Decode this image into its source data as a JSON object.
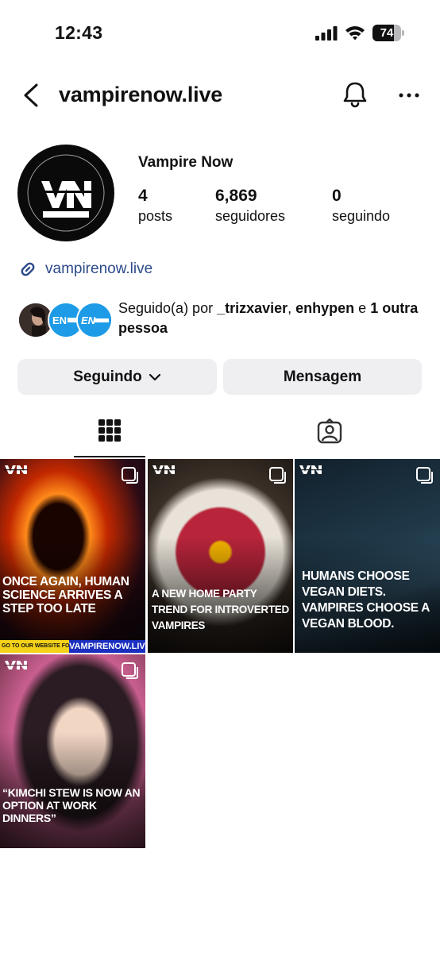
{
  "status_bar": {
    "time": "12:43",
    "battery_percent": 74
  },
  "header": {
    "username": "vampirenow.live",
    "icons": [
      "back-arrow-icon",
      "bell-icon",
      "more-icon"
    ]
  },
  "profile": {
    "display_name": "Vampire Now",
    "stats": {
      "posts_count": "4",
      "posts_label": "posts",
      "followers_count": "6,869",
      "followers_label": "seguidores",
      "following_count": "0",
      "following_label": "seguindo"
    },
    "link": "vampirenow.live",
    "followed_by": {
      "prefix": "Seguido(a) por ",
      "user1": "_trizxavier",
      "sep": ", ",
      "user2": "enhypen",
      "conj": " e ",
      "others": "1 outra pessoa"
    },
    "buttons": {
      "following": "Seguindo",
      "message": "Mensagem"
    }
  },
  "tabs": {
    "active": "grid",
    "icons": [
      "grid-icon",
      "tagged-icon"
    ]
  },
  "posts": [
    {
      "caption": "ONCE AGAIN, HUMAN SCIENCE ARRIVES A STEP TOO LATE",
      "ribbon_left": "GO TO OUR WEBSITE FOR MORE!",
      "ribbon_right": "VAMPIRENOW.LIVE"
    },
    {
      "caption": "A NEW HOME PARTY TREND FOR INTROVERTED VAMPIRES"
    },
    {
      "caption": "HUMANS CHOOSE VEGAN DIETS. VAMPIRES CHOOSE A VEGAN BLOOD."
    },
    {
      "caption": "“KIMCHI STEW IS NOW AN OPTION AT WORK DINNERS”"
    }
  ],
  "colors": {
    "link": "#2c4a8a",
    "button_bg": "#efeff2",
    "text": "#111111"
  }
}
